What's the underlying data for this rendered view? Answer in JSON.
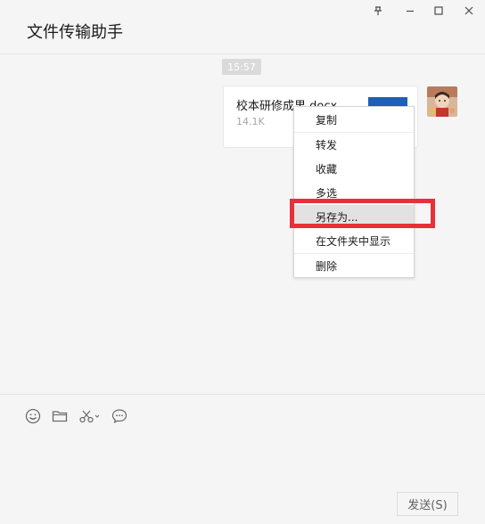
{
  "window": {
    "title": "文件传输助手",
    "controls": {
      "pin": "pin-icon",
      "minimize": "minimize-icon",
      "maximize": "maximize-icon",
      "close": "close-icon"
    }
  },
  "chat": {
    "timestamp": "15:57",
    "file_message": {
      "file_name": "校本研修成果.docx",
      "file_size": "14.1K",
      "file_icon_color": "#1f5fb5"
    }
  },
  "context_menu": {
    "items": [
      {
        "label": "复制"
      },
      {
        "label": "转发"
      },
      {
        "label": "收藏"
      },
      {
        "label": "多选"
      },
      {
        "label": "另存为..."
      },
      {
        "label": "在文件夹中显示"
      },
      {
        "label": "删除"
      }
    ],
    "highlighted_item": "另存为...",
    "highlight_color": "#e8303a"
  },
  "toolbar": {
    "icons": [
      "emoji-icon",
      "folder-icon",
      "scissors-icon",
      "chat-bubble-icon"
    ]
  },
  "send_button": {
    "label": "发送(S)"
  }
}
